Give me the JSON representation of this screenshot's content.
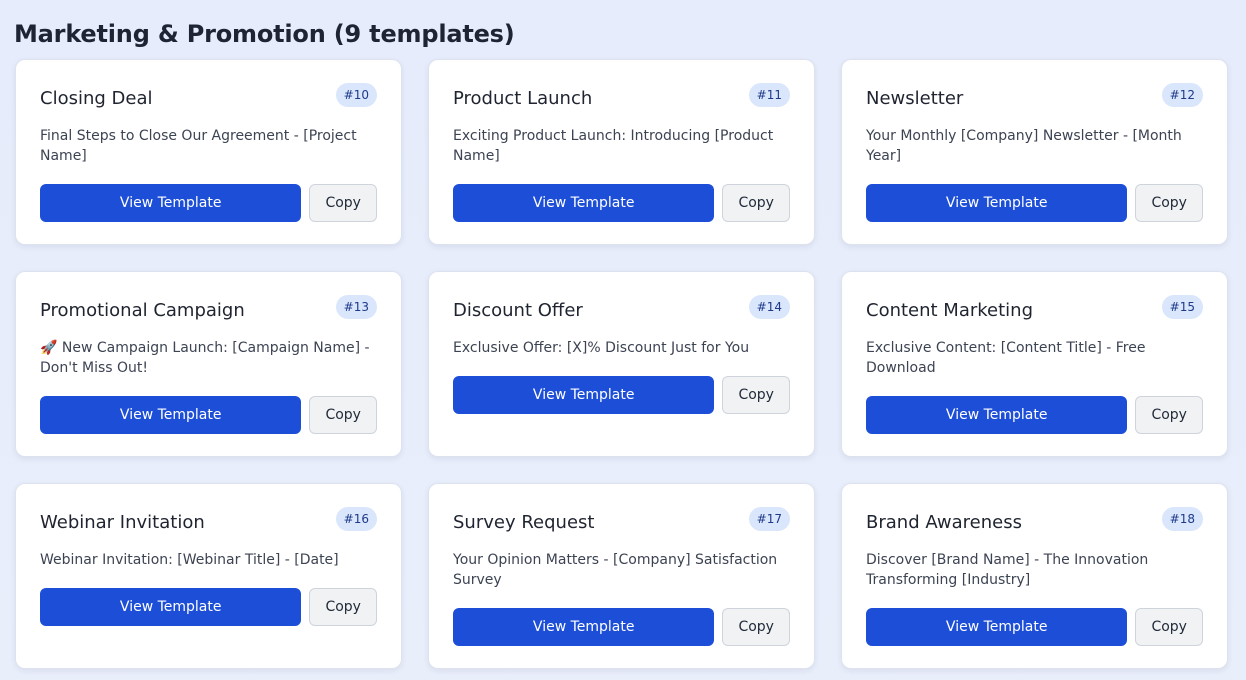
{
  "section": {
    "title": "Marketing & Promotion (9 templates)"
  },
  "colors": {
    "page_bg": "#e6ecfb",
    "primary_button": "#1d4ed8",
    "badge_bg": "#d9e6fb",
    "badge_text": "#1e3a8a"
  },
  "buttons": {
    "view_label": "View Template",
    "copy_label": "Copy"
  },
  "templates": [
    {
      "title": "Closing Deal",
      "badge": "#10",
      "subject": "Final Steps to Close Our Agreement - [Project Name]"
    },
    {
      "title": "Product Launch",
      "badge": "#11",
      "subject": "Exciting Product Launch: Introducing [Product Name]"
    },
    {
      "title": "Newsletter",
      "badge": "#12",
      "subject": "Your Monthly [Company] Newsletter - [Month Year]"
    },
    {
      "title": "Promotional Campaign",
      "badge": "#13",
      "subject": "🚀 New Campaign Launch: [Campaign Name] - Don't Miss Out!"
    },
    {
      "title": "Discount Offer",
      "badge": "#14",
      "subject": "Exclusive Offer: [X]% Discount Just for You"
    },
    {
      "title": "Content Marketing",
      "badge": "#15",
      "subject": "Exclusive Content: [Content Title] - Free Download"
    },
    {
      "title": "Webinar Invitation",
      "badge": "#16",
      "subject": "Webinar Invitation: [Webinar Title] - [Date]"
    },
    {
      "title": "Survey Request",
      "badge": "#17",
      "subject": "Your Opinion Matters - [Company] Satisfaction Survey"
    },
    {
      "title": "Brand Awareness",
      "badge": "#18",
      "subject": "Discover [Brand Name] - The Innovation Transforming [Industry]"
    }
  ]
}
